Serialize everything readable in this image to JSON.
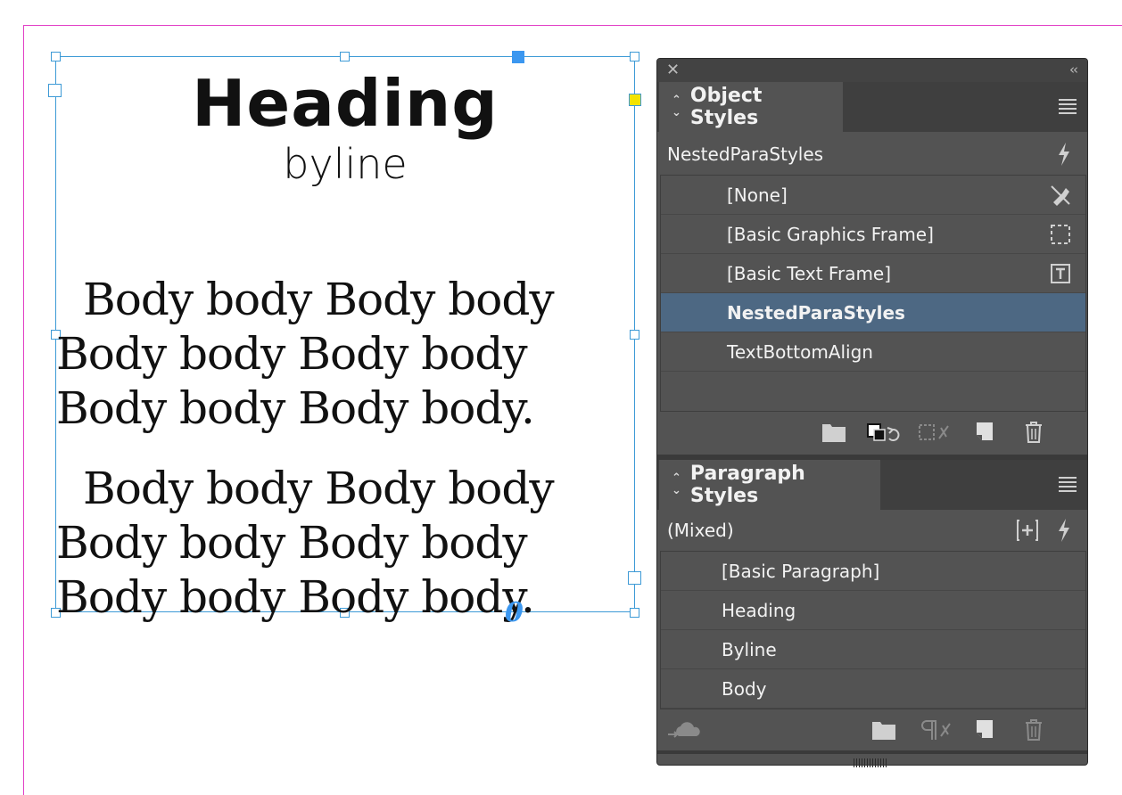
{
  "document": {
    "heading": "Heading",
    "byline": "byline",
    "body_paragraphs": [
      "Body body Body body Body body Body body Body body Body body.",
      "Body body Body body Body body Body body Body body Body body."
    ],
    "overset_marker": "0"
  },
  "object_styles_panel": {
    "tab_label": "Object Styles",
    "current_style": "NestedParaStyles",
    "items": [
      {
        "label": "[None]",
        "icon": "no-style-pen-icon",
        "selected": false
      },
      {
        "label": "[Basic Graphics Frame]",
        "icon": "graphics-frame-icon",
        "selected": false
      },
      {
        "label": "[Basic Text Frame]",
        "icon": "text-frame-icon",
        "selected": false
      },
      {
        "label": "NestedParaStyles",
        "icon": "",
        "selected": true
      },
      {
        "label": "TextBottomAlign",
        "icon": "",
        "selected": false
      }
    ],
    "footer_icons": [
      "new-group-folder-icon",
      "clear-overrides-icon",
      "clear-non-defined-icon",
      "new-style-icon",
      "delete-icon"
    ]
  },
  "paragraph_styles_panel": {
    "tab_label": "Paragraph Styles",
    "current_style": "(Mixed)",
    "items": [
      {
        "label": "[Basic Paragraph]"
      },
      {
        "label": "Heading"
      },
      {
        "label": "Byline"
      },
      {
        "label": "Body"
      }
    ],
    "footer_icons": [
      "cc-library-icon",
      "new-group-folder-icon",
      "clear-overrides-icon",
      "new-style-icon",
      "delete-icon"
    ]
  },
  "colors": {
    "margin_guide": "#e23fc6",
    "frame_edge": "#3d9ad6",
    "panel_bg": "#535353",
    "selected_row": "#4d6883"
  }
}
